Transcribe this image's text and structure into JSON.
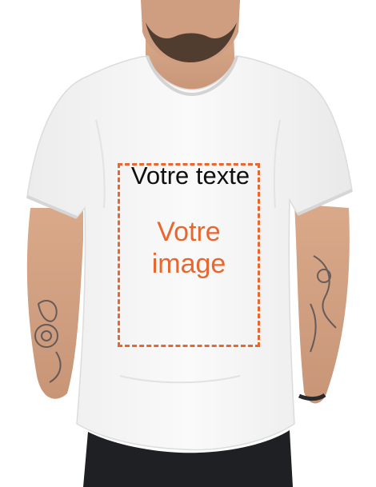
{
  "mockup": {
    "text_placeholder": "Votre texte",
    "image_placeholder_line1": "Votre",
    "image_placeholder_line2": "image"
  },
  "colors": {
    "accent": "#e8672e",
    "text": "#0f0f0f",
    "shirt": "#f7f7f7",
    "background": "#ffffff"
  }
}
